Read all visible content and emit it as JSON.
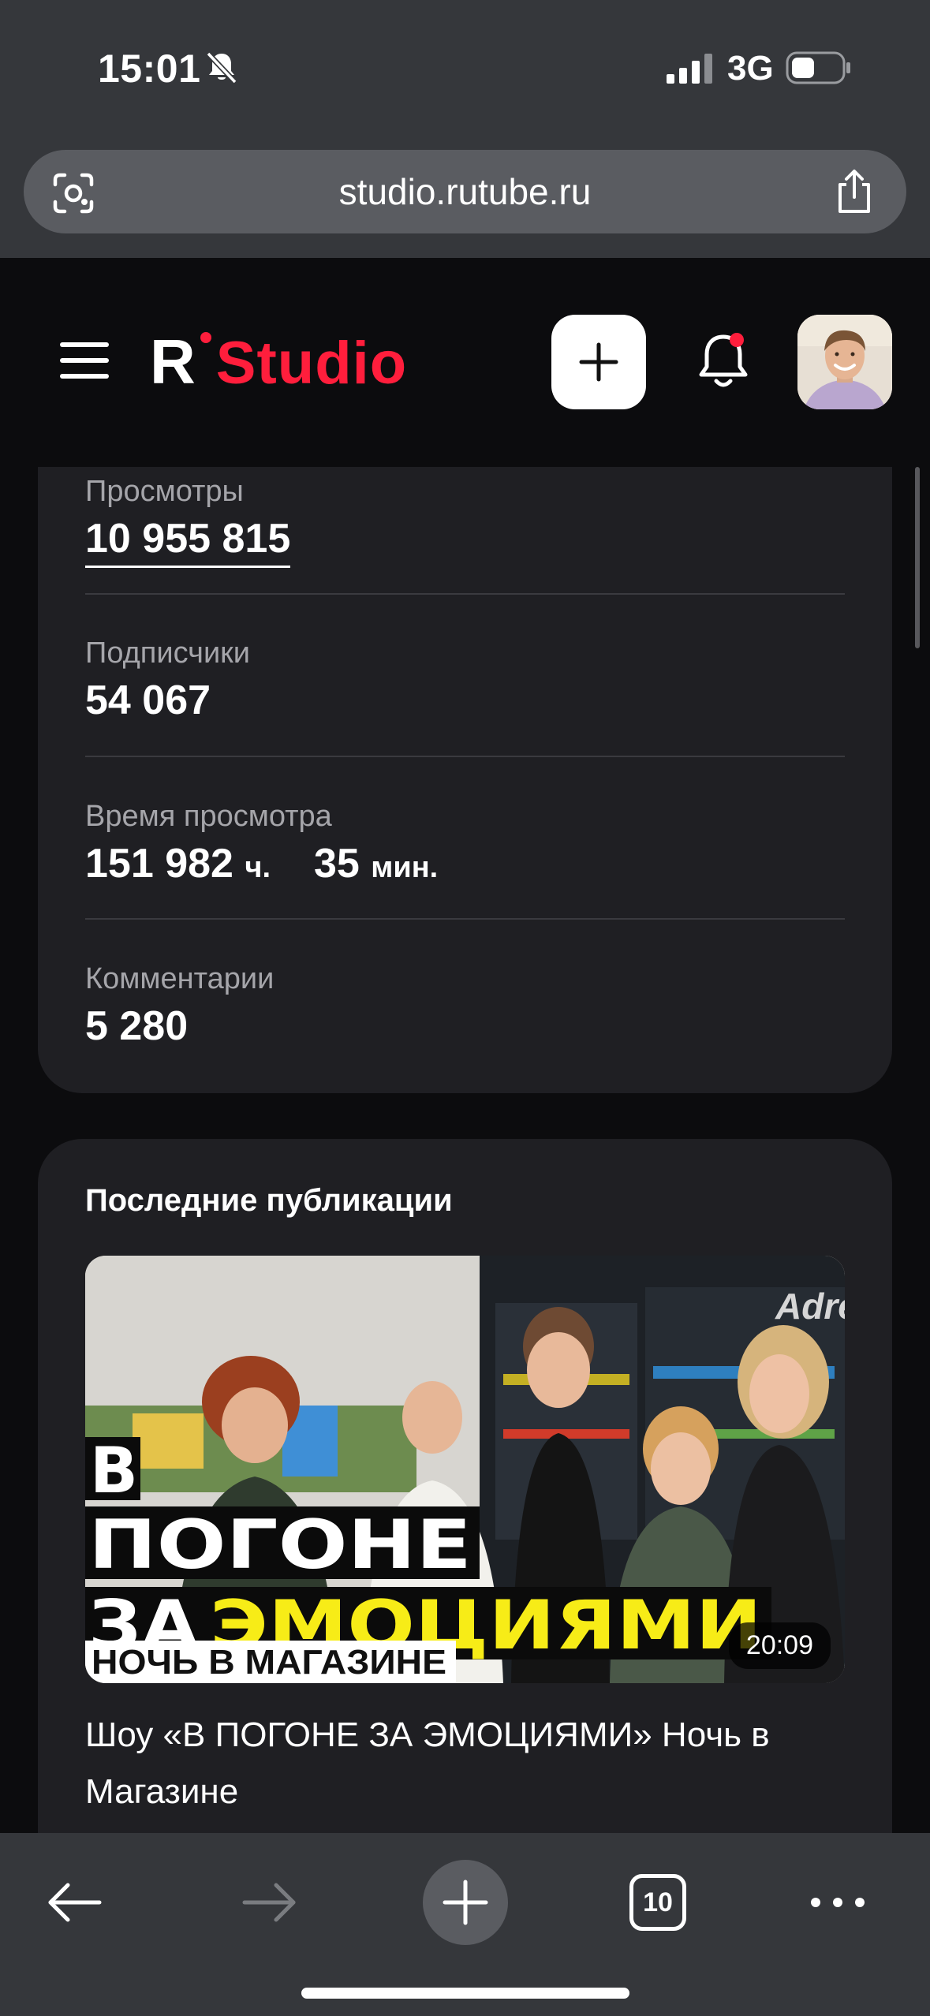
{
  "status_bar": {
    "time": "15:01",
    "network": "3G"
  },
  "browser": {
    "url": "studio.rutube.ru",
    "tabs_count": "10"
  },
  "header": {
    "logo_letter": "R",
    "logo_text": "Studio",
    "accent_color": "#ff1e3c",
    "icons": [
      "menu-icon",
      "plus-icon",
      "bell-icon",
      "avatar"
    ]
  },
  "stats": {
    "views_label": "Просмотры",
    "views_value": "10 955 815",
    "subscribers_label": "Подписчики",
    "subscribers_value": "54 067",
    "watch_time_label": "Время просмотра",
    "watch_hours": "151 982",
    "watch_hours_unit": "ч.",
    "watch_minutes": "35",
    "watch_minutes_unit": "мин.",
    "comments_label": "Комментарии",
    "comments_value": "5 280"
  },
  "publications": {
    "title": "Последние публикации",
    "video": {
      "thumb_line1": "В",
      "thumb_line2": "ПОГОНЕ",
      "thumb_line3_a": "ЗА",
      "thumb_line3_b": "ЭМОЦИЯМИ",
      "thumb_subtitle": "НОЧЬ В МАГАЗИНЕ",
      "thumb_sign": "Adre",
      "duration": "20:09",
      "title": "Шоу «В ПОГОНЕ ЗА ЭМОЦИЯМИ» Ночь в Магазине"
    }
  }
}
